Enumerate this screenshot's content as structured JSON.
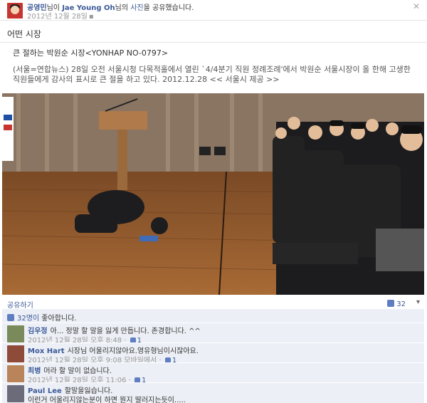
{
  "post": {
    "author": "공영민",
    "mid": "님이 ",
    "target": "Jae Young Oh",
    "mid2": "님의 ",
    "photo_link": "사진",
    "tail": "을 공유했습니다.",
    "date": "2012년 12월 28일",
    "message": "어떤 시장",
    "shared_title": "큰 절하는 박원순 시장<YONHAP NO-0797>",
    "shared_desc": "(서울=연합뉴스) 28일 오전 서울시청 다목적홀에서 열린 `4/4분기 직원 정례조례'에서 박원순 서울시장이 올 한해 고생한 직원들에게 감사의 표시로 큰 절을 하고 있다. 2012.12.28 << 서울시 제공 >>",
    "share_label": "공유하기",
    "like_count": "32",
    "likes_summary_count": "32명이",
    "likes_summary_text": " 좋아합니다."
  },
  "comments": [
    {
      "name": "김우정",
      "text": "아... 정말 할 말을 잃게 만듭니다. 존경합니다. ^^",
      "time": "2012년 12월 28일 오후 8:48",
      "likes": "1",
      "via": ""
    },
    {
      "name": "Mox Hart",
      "text": "시장님 어울리지않아요.영유형님이시잖아요.",
      "time": "2012년 12월 28일 오후 9:08",
      "likes": "1",
      "via": "모바일에서"
    },
    {
      "name": "최병",
      "text": "머라 할 말이 없습니다.",
      "time": "2012년 12월 28일 오후 11:06",
      "likes": "1",
      "via": ""
    },
    {
      "name": "Paul Lee",
      "text": "할말을잃습니다.",
      "text2": "이런거 어울리지않는분이 하면 뭔지 딸러지는듯이.....",
      "time": "",
      "likes": "",
      "via": ""
    }
  ],
  "icons": {
    "close": "close-icon",
    "thumb": "thumbs-up-icon",
    "more": "options-icon"
  },
  "colors": {
    "link": "#3b5998",
    "comment_bg": "#eceff5"
  }
}
